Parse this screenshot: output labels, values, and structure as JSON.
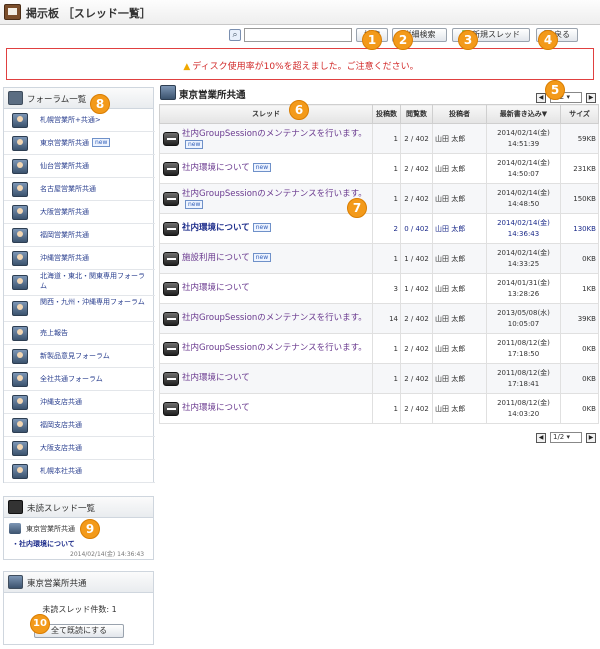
{
  "window": {
    "title": "掲示板 ［スレッド一覧］"
  },
  "toolbar": {
    "search_placeholder": "",
    "search_button": "検索",
    "detail_search_button": "詳細検索",
    "new_thread_button": "新規スレッド",
    "back_button": "戻る"
  },
  "warning": {
    "icon": "warning-triangle-icon",
    "text": "ディスク使用率が10%を超えました。ご注意ください。"
  },
  "sidebar": {
    "forum_list_title": "フォーラム一覧",
    "forums": [
      {
        "label": "札幌営業所+共通>",
        "new": false
      },
      {
        "label": "東京営業所共通",
        "new": true,
        "badge": "new"
      },
      {
        "label": "仙台営業所共通",
        "new": false
      },
      {
        "label": "名古屋営業所共通",
        "new": false
      },
      {
        "label": "大阪営業所共通",
        "new": false
      },
      {
        "label": "福岡営業所共通",
        "new": false
      },
      {
        "label": "沖縄営業所共通",
        "new": false
      },
      {
        "label": "北海道・東北・関東専用フォーラム",
        "new": false
      },
      {
        "label": "関西・九州・沖縄専用フォーラム",
        "new": false
      },
      {
        "label": "売上報告",
        "new": false
      },
      {
        "label": "新製品意見フォーラム",
        "new": false
      },
      {
        "label": "全社共通フォーラム",
        "new": false
      },
      {
        "label": "沖縄支店共通",
        "new": false
      },
      {
        "label": "福岡支店共通",
        "new": false
      },
      {
        "label": "大阪支店共通",
        "new": false
      },
      {
        "label": "札幌本社共通",
        "new": false
      }
    ],
    "unread_title": "未読スレッド一覧",
    "unread_forum": "東京営業所共通",
    "unread_thread": "・社内環境について",
    "unread_date": "2014/02/14(金) 14:36:43",
    "forum_box_title": "東京営業所共通",
    "unread_count_text": "未読スレッド件数: 1",
    "mark_read_button": "全て既読にする"
  },
  "main": {
    "title": "東京営業所共通",
    "page_select": "1/2",
    "columns": [
      "スレッド",
      "投稿数",
      "閲覧数",
      "投稿者",
      "最新書き込み▼",
      "サイズ"
    ],
    "threads": [
      {
        "title": "社内GroupSessionのメンテナンスを行います。",
        "new": true,
        "bold": false,
        "posts": "1",
        "views": "2 / 402",
        "author": "山田 太郎",
        "date1": "2014/02/14(金)",
        "date2": "14:51:39",
        "size": "59KB"
      },
      {
        "title": "社内環境について",
        "new": true,
        "bold": false,
        "posts": "1",
        "views": "2 / 402",
        "author": "山田 太郎",
        "date1": "2014/02/14(金)",
        "date2": "14:50:07",
        "size": "231KB"
      },
      {
        "title": "社内GroupSessionのメンテナンスを行います。",
        "new": true,
        "bold": false,
        "posts": "1",
        "views": "2 / 402",
        "author": "山田 太郎",
        "date1": "2014/02/14(金)",
        "date2": "14:48:50",
        "size": "150KB"
      },
      {
        "title": "社内環境について",
        "new": true,
        "bold": true,
        "posts": "2",
        "views": "0 / 402",
        "author": "山田 太郎",
        "date1": "2014/02/14(金)",
        "date2": "14:36:43",
        "size": "130KB"
      },
      {
        "title": "施設利用について",
        "new": true,
        "bold": false,
        "posts": "1",
        "views": "1 / 402",
        "author": "山田 太郎",
        "date1": "2014/02/14(金)",
        "date2": "14:33:25",
        "size": "0KB"
      },
      {
        "title": "社内環境について",
        "new": false,
        "bold": false,
        "posts": "3",
        "views": "1 / 402",
        "author": "山田 太郎",
        "date1": "2014/01/31(金)",
        "date2": "13:28:26",
        "size": "1KB"
      },
      {
        "title": "社内GroupSessionのメンテナンスを行います。",
        "new": false,
        "bold": false,
        "posts": "14",
        "views": "2 / 402",
        "author": "山田 太郎",
        "date1": "2013/05/08(水)",
        "date2": "10:05:07",
        "size": "39KB"
      },
      {
        "title": "社内GroupSessionのメンテナンスを行います。",
        "new": false,
        "bold": false,
        "posts": "1",
        "views": "2 / 402",
        "author": "山田 太郎",
        "date1": "2011/08/12(金)",
        "date2": "17:18:50",
        "size": "0KB"
      },
      {
        "title": "社内環境について",
        "new": false,
        "bold": false,
        "posts": "1",
        "views": "2 / 402",
        "author": "山田 太郎",
        "date1": "2011/08/12(金)",
        "date2": "17:18:41",
        "size": "0KB"
      },
      {
        "title": "社内環境について",
        "new": false,
        "bold": false,
        "posts": "1",
        "views": "2 / 402",
        "author": "山田 太郎",
        "date1": "2011/08/12(金)",
        "date2": "14:03:20",
        "size": "0KB"
      }
    ]
  },
  "markers": [
    "1",
    "2",
    "3",
    "4",
    "5",
    "6",
    "7",
    "8",
    "9",
    "10"
  ],
  "colors": {
    "accent": "#f39a1a",
    "warning": "#d22a2a",
    "link": "#1c2b8a",
    "visited": "#6a3a8f"
  }
}
